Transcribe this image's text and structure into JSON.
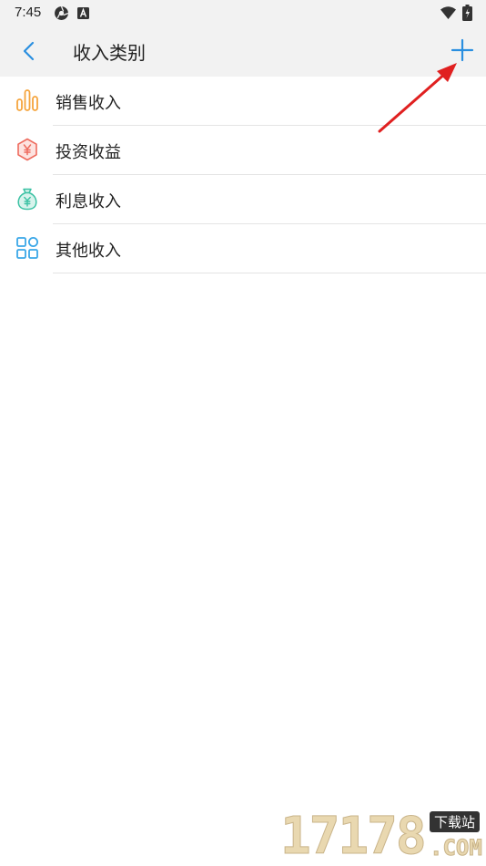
{
  "status_bar": {
    "time": "7:45",
    "left_icons": [
      "settings-icon",
      "a-badge-icon"
    ],
    "right_icons": [
      "wifi-icon",
      "battery-icon"
    ]
  },
  "header": {
    "back_icon": "chevron-left-icon",
    "title": "收入类别",
    "add_icon": "plus-icon"
  },
  "categories": [
    {
      "label": "销售收入",
      "icon": "bar-chart-icon",
      "color": "#f5a43c"
    },
    {
      "label": "投资收益",
      "icon": "hexagon-yen-icon",
      "color": "#ee6b5e"
    },
    {
      "label": "利息收入",
      "icon": "money-bag-yen-icon",
      "color": "#3cc2a4"
    },
    {
      "label": "其他收入",
      "icon": "grid-apps-icon",
      "color": "#3aa7e8"
    }
  ],
  "annotation": {
    "color": "#e02020"
  },
  "watermark": {
    "number": "17178",
    "tag": "下载站",
    "suffix": ".COM"
  },
  "colors": {
    "accent": "#2a8fe0",
    "background": "#ffffff",
    "header_bg": "#f2f2f2",
    "divider": "#e4e4e4"
  }
}
